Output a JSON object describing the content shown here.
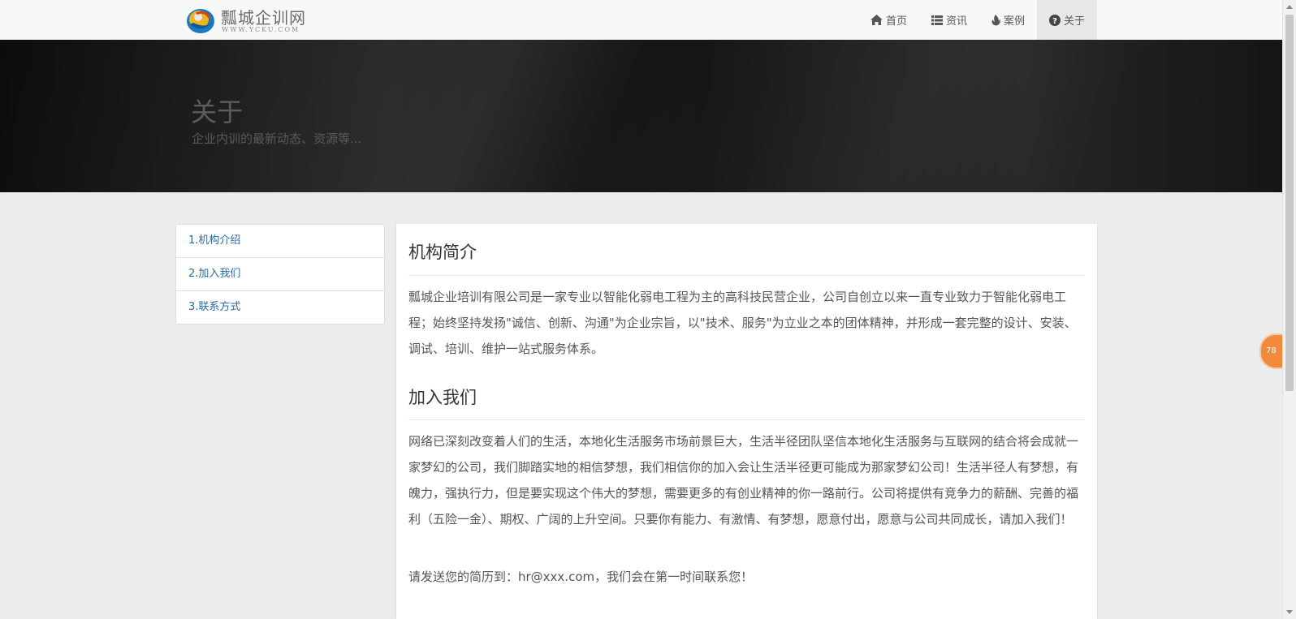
{
  "brand": {
    "name": "瓢城企训网",
    "domain": "WWW.YCKU.COM",
    "logo_icon": "globe-logo-icon"
  },
  "nav": [
    {
      "label": "首页",
      "icon": "home-icon",
      "active": false
    },
    {
      "label": "资讯",
      "icon": "list-icon",
      "active": false
    },
    {
      "label": "案例",
      "icon": "fire-icon",
      "active": false
    },
    {
      "label": "关于",
      "icon": "question-circle-icon",
      "active": true
    }
  ],
  "hero": {
    "title": "关于",
    "subtitle": "企业内训的最新动态、资源等..."
  },
  "sidebar": {
    "items": [
      {
        "label": "1.机构介绍"
      },
      {
        "label": "2.加入我们"
      },
      {
        "label": "3.联系方式"
      }
    ]
  },
  "content": {
    "sections": [
      {
        "heading": "机构简介",
        "paragraphs": [
          "瓢城企业培训有限公司是一家专业以智能化弱电工程为主的高科技民营企业，公司自创立以来一直专业致力于智能化弱电工程；始终坚持发扬\"诚信、创新、沟通\"为企业宗旨，以\"技术、服务\"为立业之本的团体精神，并形成一套完整的设计、安装、调试、培训、维护一站式服务体系。"
        ]
      },
      {
        "heading": "加入我们",
        "paragraphs": [
          "网络已深刻改变着人们的生活，本地化生活服务市场前景巨大，生活半径团队坚信本地化生活服务与互联网的结合将会成就一家梦幻的公司，我们脚踏实地的相信梦想，我们相信你的加入会让生活半径更可能成为那家梦幻公司！生活半径人有梦想，有魄力，强执行力，但是要实现这个伟大的梦想，需要更多的有创业精神的你一路前行。公司将提供有竞争力的薪酬、完善的福利（五险一金）、期权、广阔的上升空间。只要你有能力、有激情、有梦想，愿意付出，愿意与公司共同成长，请加入我们！",
          "请发送您的简历到：hr@xxx.com，我们会在第一时间联系您！"
        ]
      }
    ]
  },
  "floating_badge": {
    "label": "78"
  },
  "colors": {
    "link": "#2a6aa8",
    "badge": "#f18a3c"
  }
}
